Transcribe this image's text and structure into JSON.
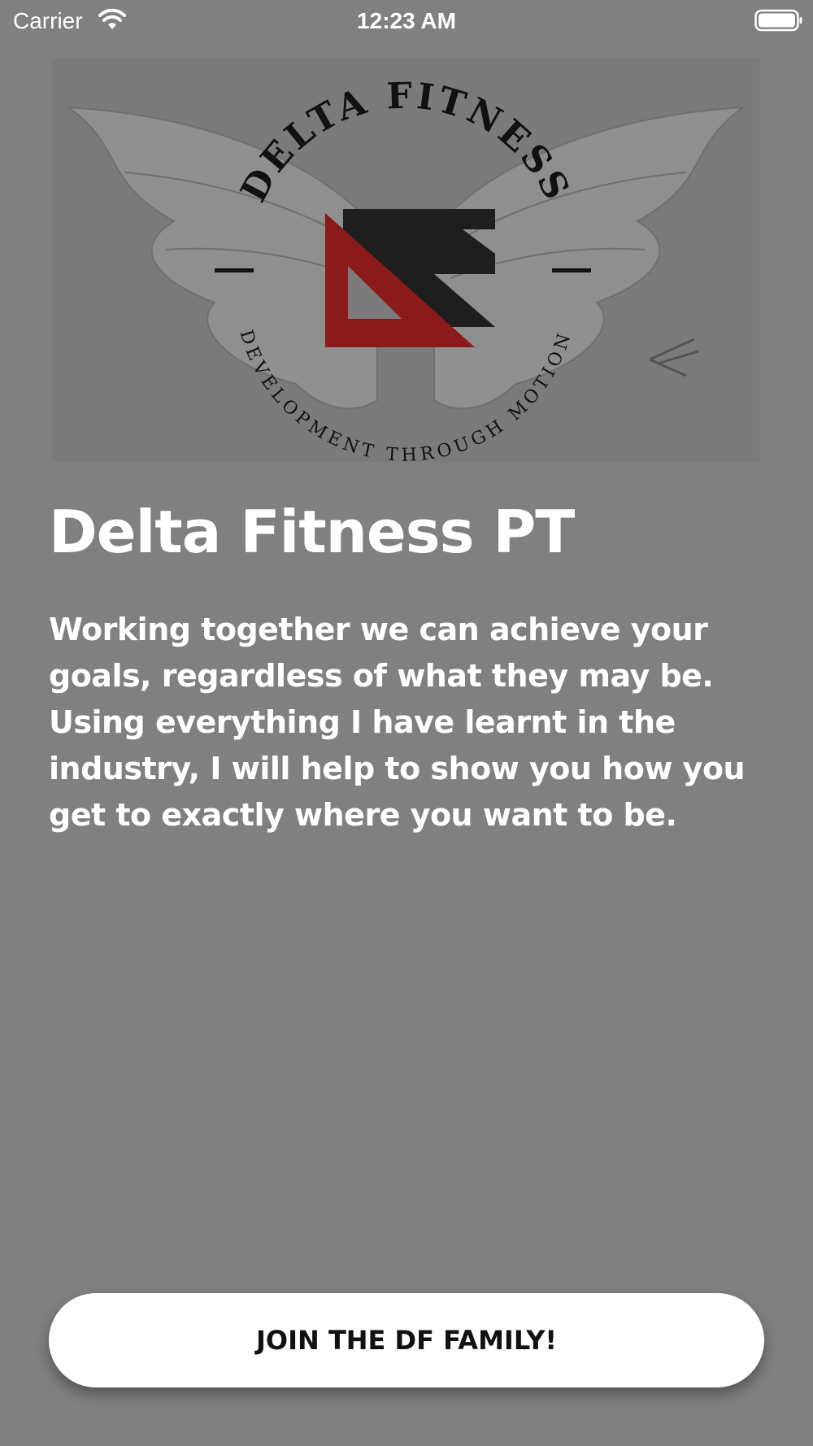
{
  "status_bar": {
    "carrier": "Carrier",
    "time": "12:23 AM",
    "wifi_icon": "wifi-icon",
    "battery_icon": "battery-icon"
  },
  "logo": {
    "top_text": "DELTA FITNESS",
    "bottom_text": "DEVELOPMENT THROUGH MOTION",
    "monogram": "DF",
    "accent_color": "#8b1a1a"
  },
  "main": {
    "title": "Delta Fitness PT",
    "description": "Working together we can achieve your goals, regardless of what they may be. Using everything I have learnt in the industry, I will help to show you how you get to exactly where you want to be."
  },
  "cta": {
    "label": "JOIN THE DF FAMILY!"
  },
  "colors": {
    "background": "#808080",
    "text": "#ffffff",
    "button_bg": "#ffffff",
    "button_text": "#111111"
  }
}
